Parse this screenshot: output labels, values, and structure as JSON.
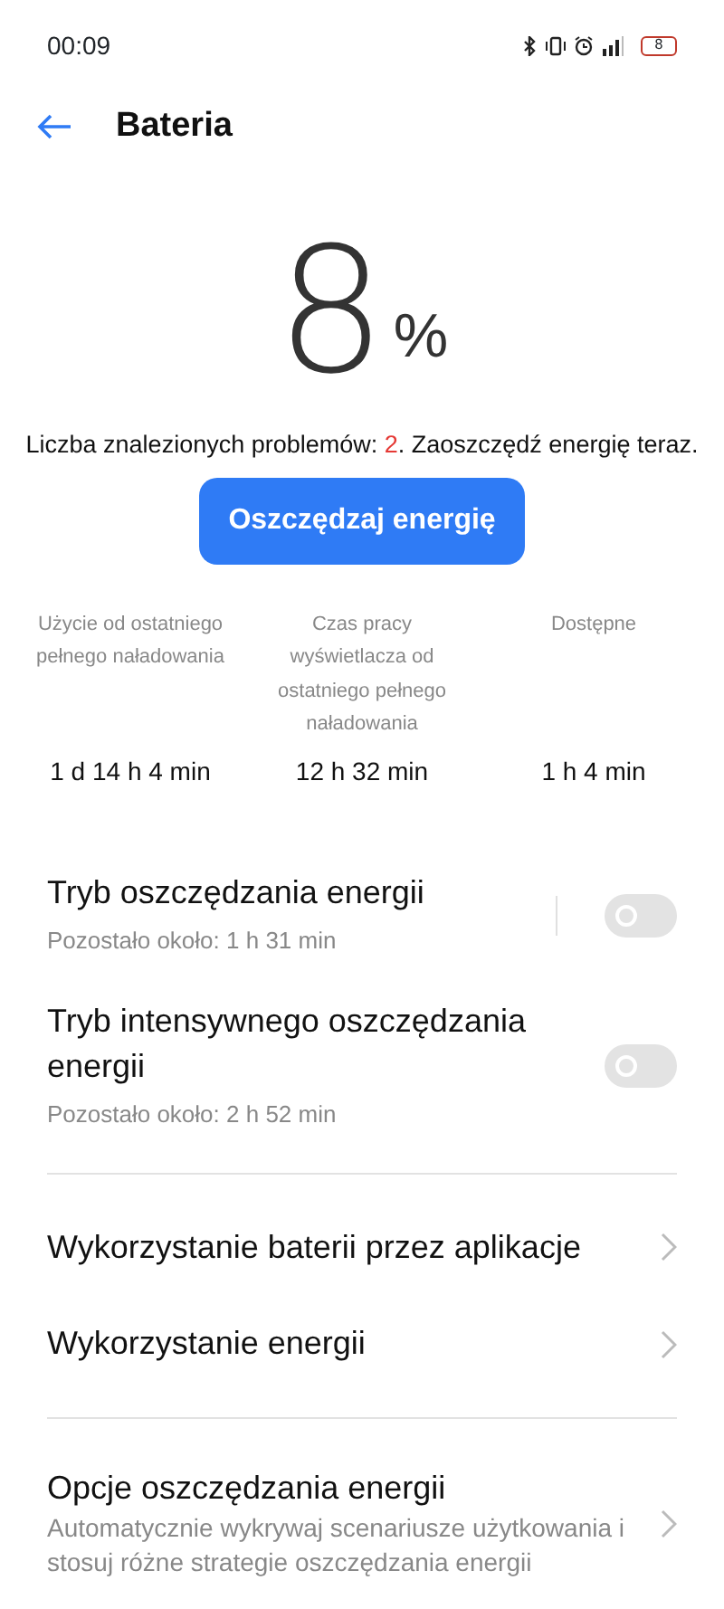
{
  "status_bar": {
    "time": "00:09",
    "battery": "8"
  },
  "header": {
    "title": "Bateria"
  },
  "battery": {
    "percent": "8",
    "unit": "%"
  },
  "problems": {
    "prefix": "Liczba znalezionych problemów: ",
    "count": "2",
    "suffix": ". Zaoszczędź energię teraz."
  },
  "save_button": "Oszczędzaj energię",
  "stats": [
    {
      "label": "Użycie od ostatniego pełnego naładowania",
      "value": "1 d 14 h 4 min"
    },
    {
      "label": "Czas pracy wyświetlacza od ostatniego pełnego naładowania",
      "value": "12 h 32 min"
    },
    {
      "label": "Dostępne",
      "value": "1 h 4 min"
    }
  ],
  "modes": [
    {
      "title": "Tryb oszczędzania energii",
      "subtitle": "Pozostało około:  1 h 31 min",
      "on": false,
      "separator": true
    },
    {
      "title": "Tryb intensywnego oszczędzania energii",
      "subtitle": "Pozostało około:  2 h 52 min",
      "on": false,
      "separator": false
    }
  ],
  "links": [
    {
      "title": "Wykorzystanie baterii przez aplikacje"
    },
    {
      "title": "Wykorzystanie energii"
    }
  ],
  "options": [
    {
      "title": "Opcje oszczędzania energii",
      "description": "Automatycznie wykrywaj scenariusze użytkowania i stosuj różne strategie oszczędzania energii"
    }
  ]
}
